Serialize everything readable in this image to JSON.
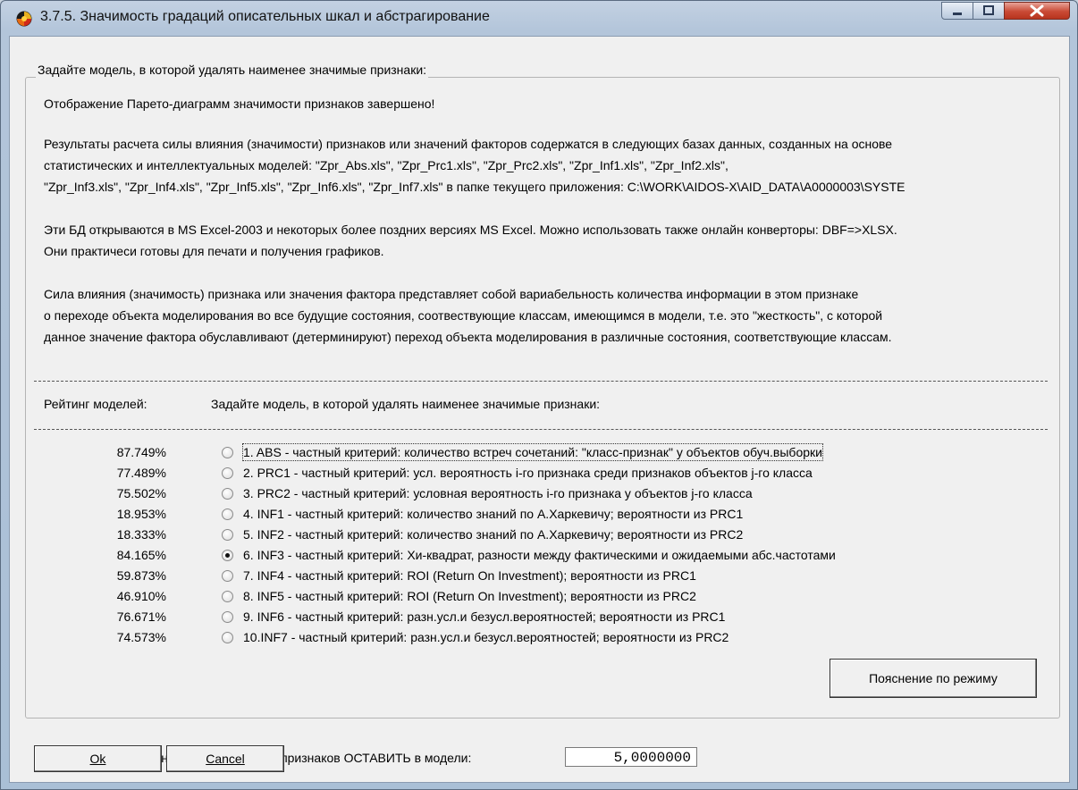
{
  "window": {
    "title": "3.7.5. Значимость градаций описательных шкал и абстрагирование"
  },
  "group": {
    "title": "Задайте модель, в которой удалять наименее значимые признаки:"
  },
  "messages": {
    "completed": "Отображение Парето-диаграмм значимости признаков завершено!",
    "results_line1": "Результаты расчета силы влияния (значимости) признаков или значений факторов содержатся в следующих базах данных, созданных на основе",
    "results_line2": "статистических и интеллектуальных моделей: \"Zpr_Abs.xls\", \"Zpr_Prc1.xls\", \"Zpr_Prc2.xls\", \"Zpr_Inf1.xls\", \"Zpr_Inf2.xls\",",
    "results_line3": "\"Zpr_Inf3.xls\", \"Zpr_Inf4.xls\", \"Zpr_Inf5.xls\", \"Zpr_Inf6.xls\", \"Zpr_Inf7.xls\" в папке текущего приложения: C:\\WORK\\AIDOS-X\\AID_DATA\\A0000003\\SYSTE",
    "excel_line1": "Эти БД открываются в MS Excel-2003 и некоторых более поздних версиях MS Excel. Можно использовать также онлайн конверторы: DBF=>XLSX.",
    "excel_line2": "Они практичеси готовы для печати и получения графиков.",
    "force_line1": "Сила влияния (значимость) признака или значения фактора представляет собой вариабельность количества информации в этом признаке",
    "force_line2": "о переходе объекта моделирования во все будущие состояния, соотвествующие классам, имеющимся в модели, т.е. это \"жесткость\", с которой",
    "force_line3": "данное значение фактора обуславливают (детерминируют) переход объекта моделирования в различные состояния, соответствующие классам."
  },
  "headers": {
    "rating": "Рейтинг моделей:",
    "choose": "Задайте модель, в которой удалять наименее значимые признаки:"
  },
  "models": [
    {
      "pct": "87.749%",
      "label": "1. ABS  - частный критерий: количество встреч сочетаний: \"класс-признак\" у объектов обуч.выборки",
      "checked": false
    },
    {
      "pct": "77.489%",
      "label": "2. PRC1 - частный критерий: усл. вероятность i-го признака среди признаков объектов j-го класса",
      "checked": false
    },
    {
      "pct": "75.502%",
      "label": "3. PRC2 - частный критерий: условная вероятность i-го признака у объектов j-го класса",
      "checked": false
    },
    {
      "pct": "18.953%",
      "label": "4. INF1 - частный критерий: количество знаний по А.Харкевичу; вероятности из PRC1",
      "checked": false
    },
    {
      "pct": "18.333%",
      "label": "5. INF2 - частный критерий: количество знаний по А.Харкевичу; вероятности из PRC2",
      "checked": false
    },
    {
      "pct": "84.165%",
      "label": "6. INF3 - частный критерий: Хи-квадрат, разности между фактическими и ожидаемыми абс.частотами",
      "checked": true
    },
    {
      "pct": "59.873%",
      "label": "7. INF4 - частный критерий: ROI (Return On Investment); вероятности из PRC1",
      "checked": false
    },
    {
      "pct": "46.910%",
      "label": "8. INF5 - частный критерий: ROI (Return On Investment); вероятности из PRC2",
      "checked": false
    },
    {
      "pct": "76.671%",
      "label": "9. INF6 - частный критерий: разн.усл.и безусл.вероятностей; вероятности из PRC1",
      "checked": false
    },
    {
      "pct": "74.573%",
      "label": "10.INF7 - частный критерий: разн.усл.и безусл.вероятностей; вероятности из PRC2",
      "checked": false
    }
  ],
  "keep": {
    "label": "Задайте какой % наиболее значимых признаков ОСТАВИТЬ в модели:",
    "value": "5,0000000"
  },
  "buttons": {
    "explain": "Пояснение по режиму",
    "ok": "Ok",
    "cancel": "Cancel"
  },
  "colors": {
    "title_bg": "#b9cadf",
    "client_bg": "#f0f0f0",
    "close_red": "#c94a35"
  }
}
